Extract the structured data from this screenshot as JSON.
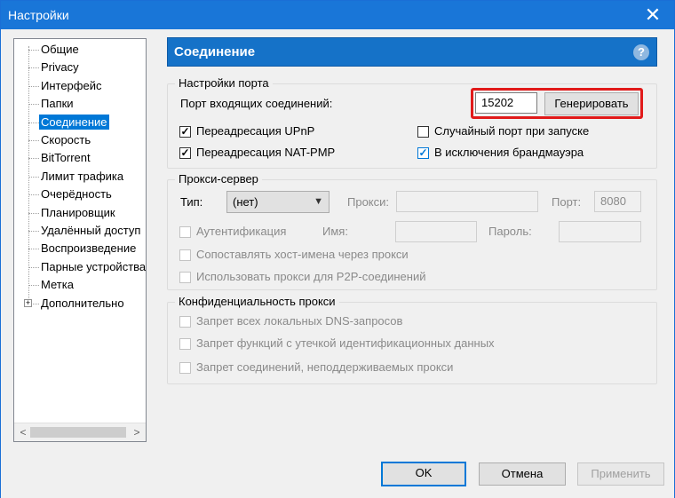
{
  "window": {
    "title": "Настройки",
    "close_glyph": "✕"
  },
  "tree": {
    "items": [
      {
        "label": "Общие"
      },
      {
        "label": "Privacy"
      },
      {
        "label": "Интерфейс"
      },
      {
        "label": "Папки"
      },
      {
        "label": "Соединение",
        "selected": true
      },
      {
        "label": "Скорость"
      },
      {
        "label": "BitTorrent"
      },
      {
        "label": "Лимит трафика"
      },
      {
        "label": "Очерёдность"
      },
      {
        "label": "Планировщик"
      },
      {
        "label": "Удалённый доступ"
      },
      {
        "label": "Воспроизведение"
      },
      {
        "label": "Парные устройства"
      },
      {
        "label": "Метка"
      },
      {
        "label": "Дополнительно",
        "expandable": true
      }
    ],
    "expander_glyph": "+",
    "scroll_left": "<",
    "scroll_right": ">"
  },
  "header": {
    "title": "Соединение",
    "help_glyph": "?"
  },
  "port_settings": {
    "group_title": "Настройки порта",
    "incoming_label": "Порт входящих соединений:",
    "port_value": "15202",
    "generate_button": "Генерировать",
    "upnp_label": "Переадресация UPnP",
    "upnp_checked": true,
    "natpmp_label": "Переадресация NAT-PMP",
    "natpmp_checked": true,
    "random_port_label": "Случайный порт при запуске",
    "random_port_checked": false,
    "firewall_label": "В исключения брандмауэра",
    "firewall_checked": true
  },
  "proxy": {
    "group_title": "Прокси-сервер",
    "type_label": "Тип:",
    "type_value": "(нет)",
    "proxy_label": "Прокси:",
    "port_label": "Порт:",
    "port_value": "8080",
    "auth_label": "Аутентификация",
    "name_label": "Имя:",
    "password_label": "Пароль:",
    "resolve_label": "Сопоставлять хост-имена через прокси",
    "p2p_label": "Использовать прокси для P2P-соединений"
  },
  "privacy": {
    "group_title": "Конфиденциальность прокси",
    "dns_label": "Запрет всех локальных DNS-запросов",
    "leak_label": "Запрет функций с утечкой идентификационных данных",
    "unsupported_label": "Запрет соединений, неподдерживаемых прокси"
  },
  "buttons": {
    "ok": "OK",
    "cancel": "Отмена",
    "apply": "Применить"
  }
}
